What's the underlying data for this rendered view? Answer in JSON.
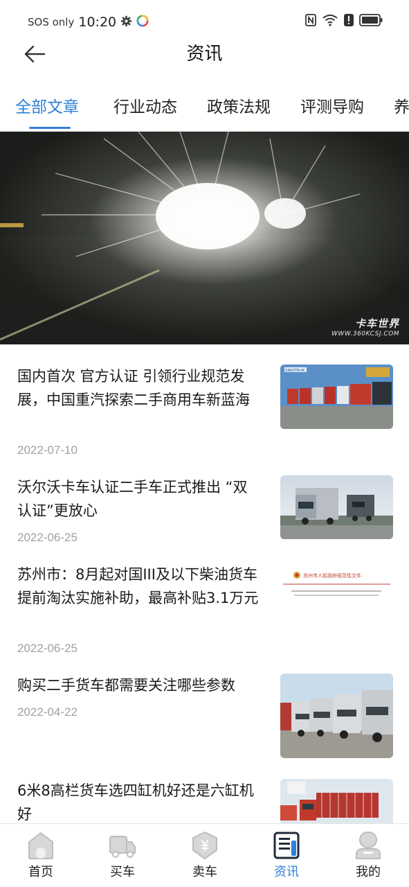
{
  "status_bar": {
    "carrier": "SOS only",
    "time": "10:20"
  },
  "header": {
    "title": "资讯",
    "back_icon": "arrow-left-icon"
  },
  "tabs": [
    {
      "label": "全部文章",
      "active": true
    },
    {
      "label": "行业动态",
      "active": false
    },
    {
      "label": "政策法规",
      "active": false
    },
    {
      "label": "评测导购",
      "active": false
    },
    {
      "label": "养",
      "active": false
    }
  ],
  "banner": {
    "watermark_brand": "卡车世界",
    "watermark_url": "WWW.360KCSJ.COM"
  },
  "articles": [
    {
      "title": "国内首次 官方认证 引领行业规范发展，中国重汽探索二手商用车新蓝海",
      "date": "2022-07-10",
      "thumb_badge": "SINOTRUK"
    },
    {
      "title": "沃尔沃卡车认证二手车正式推出 “双认证”更放心",
      "date": "2022-06-25"
    },
    {
      "title": "苏州市：8月起对国III及以下柴油货车提前淘汰实施补助，最高补贴3.1万元",
      "date": "2022-06-25",
      "thumb_heading": "苏州市人民政府规范性文件"
    },
    {
      "title": "购买二手货车都需要关注哪些参数",
      "date": "2022-04-22"
    },
    {
      "title": "6米8高栏货车选四缸机好还是六缸机好",
      "date": ""
    }
  ],
  "bottom_nav": [
    {
      "label": "首页",
      "icon": "home-icon",
      "active": false
    },
    {
      "label": "买车",
      "icon": "truck-icon",
      "active": false
    },
    {
      "label": "卖车",
      "icon": "yuan-shield-icon",
      "active": false
    },
    {
      "label": "资讯",
      "icon": "news-icon",
      "active": true
    },
    {
      "label": "我的",
      "icon": "profile-icon",
      "active": false
    }
  ],
  "colors": {
    "accent": "#2e80d8",
    "date_gray": "#a0a0a0",
    "icon_gray": "#c8c8c8"
  }
}
